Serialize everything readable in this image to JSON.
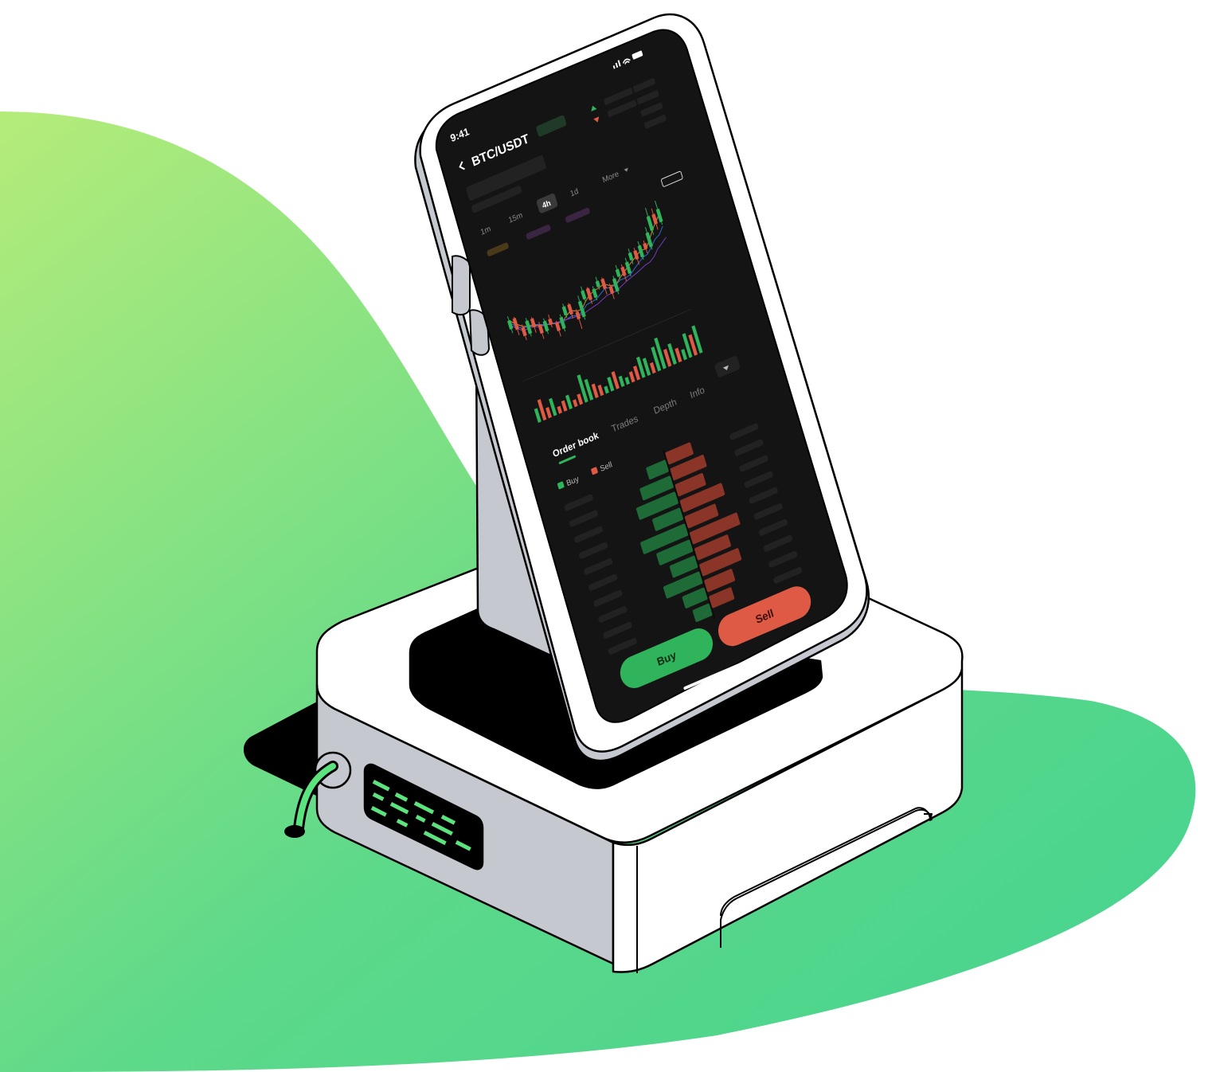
{
  "colors": {
    "blob_start": "#b5ec7a",
    "blob_end": "#45d38f",
    "screen_bg": "#141414",
    "up": "#2fb35b",
    "down": "#df5a44",
    "ma1": "#e58b2b",
    "ma2": "#2f6dd6",
    "ma3": "#7b3ec6",
    "device_light": "#ffffff",
    "device_gray": "#c5c9cf",
    "outline": "#000000"
  },
  "status_bar": {
    "time": "9:41",
    "icons": [
      "cellular-signal-icon",
      "wifi-icon",
      "battery-icon"
    ]
  },
  "header": {
    "back_icon": "chevron-left-icon",
    "pair": "BTC/USDT"
  },
  "timeframes": {
    "items": [
      "1m",
      "15m",
      "4h",
      "1d",
      "More"
    ],
    "selected": "4h",
    "more_icon": "caret-down-icon"
  },
  "chart_data": {
    "type": "candlestick",
    "title": "",
    "candles": [
      {
        "o": 52,
        "c": 58,
        "h": 61,
        "l": 49
      },
      {
        "o": 58,
        "c": 50,
        "h": 59,
        "l": 46
      },
      {
        "o": 50,
        "c": 44,
        "h": 52,
        "l": 41
      },
      {
        "o": 44,
        "c": 53,
        "h": 55,
        "l": 42
      },
      {
        "o": 53,
        "c": 47,
        "h": 54,
        "l": 43
      },
      {
        "o": 47,
        "c": 41,
        "h": 49,
        "l": 37
      },
      {
        "o": 41,
        "c": 48,
        "h": 50,
        "l": 39
      },
      {
        "o": 48,
        "c": 44,
        "h": 51,
        "l": 42
      },
      {
        "o": 44,
        "c": 38,
        "h": 45,
        "l": 34
      },
      {
        "o": 38,
        "c": 46,
        "h": 48,
        "l": 36
      },
      {
        "o": 46,
        "c": 52,
        "h": 54,
        "l": 44
      },
      {
        "o": 52,
        "c": 45,
        "h": 53,
        "l": 42
      },
      {
        "o": 45,
        "c": 40,
        "h": 47,
        "l": 33
      },
      {
        "o": 40,
        "c": 51,
        "h": 55,
        "l": 38
      },
      {
        "o": 51,
        "c": 57,
        "h": 60,
        "l": 49
      },
      {
        "o": 57,
        "c": 49,
        "h": 58,
        "l": 46
      },
      {
        "o": 49,
        "c": 55,
        "h": 57,
        "l": 47
      },
      {
        "o": 55,
        "c": 59,
        "h": 62,
        "l": 53
      },
      {
        "o": 59,
        "c": 52,
        "h": 60,
        "l": 48
      },
      {
        "o": 52,
        "c": 47,
        "h": 54,
        "l": 43
      },
      {
        "o": 47,
        "c": 56,
        "h": 58,
        "l": 45
      },
      {
        "o": 56,
        "c": 61,
        "h": 64,
        "l": 54
      },
      {
        "o": 61,
        "c": 55,
        "h": 63,
        "l": 51
      },
      {
        "o": 55,
        "c": 63,
        "h": 66,
        "l": 53
      },
      {
        "o": 63,
        "c": 68,
        "h": 71,
        "l": 60
      },
      {
        "o": 68,
        "c": 62,
        "h": 70,
        "l": 58
      },
      {
        "o": 62,
        "c": 70,
        "h": 73,
        "l": 60
      },
      {
        "o": 70,
        "c": 66,
        "h": 72,
        "l": 63
      },
      {
        "o": 66,
        "c": 76,
        "h": 80,
        "l": 64
      },
      {
        "o": 76,
        "c": 86,
        "h": 92,
        "l": 73
      },
      {
        "o": 86,
        "c": 79,
        "h": 90,
        "l": 75
      },
      {
        "o": 79,
        "c": 88,
        "h": 94,
        "l": 77
      }
    ],
    "volume": [
      4,
      6,
      3,
      5,
      2,
      3,
      4,
      2,
      3,
      8,
      6,
      4,
      3,
      2,
      4,
      5,
      3,
      2,
      3,
      4,
      6,
      5,
      3,
      7,
      9,
      5,
      6,
      4,
      3,
      7,
      6,
      8
    ]
  },
  "tabs": {
    "items": [
      "Order book",
      "Trades",
      "Depth",
      "Info"
    ],
    "active": "Order book"
  },
  "legend": {
    "buy": "Buy",
    "sell": "Sell"
  },
  "order_book": {
    "buy_depth": [
      0.35,
      0.55,
      0.7,
      0.5,
      0.8,
      0.6,
      0.45,
      0.65,
      0.4,
      0.3
    ],
    "sell_depth": [
      0.45,
      0.6,
      0.5,
      0.75,
      0.55,
      0.85,
      0.6,
      0.7,
      0.5,
      0.4
    ]
  },
  "actions": {
    "buy_label": "Buy",
    "sell_label": "Sell"
  }
}
